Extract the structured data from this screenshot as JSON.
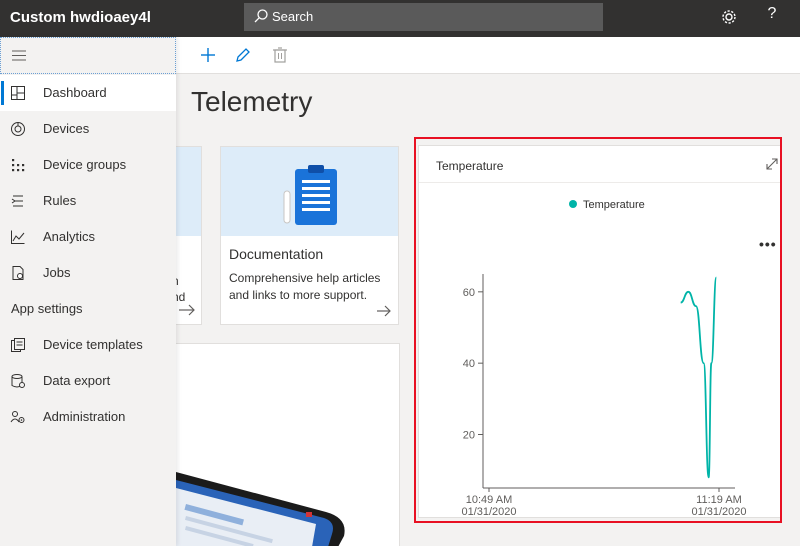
{
  "header": {
    "app_title": "Custom hwdioaey4l",
    "search_placeholder": "Search",
    "icons": {
      "search": "search-icon",
      "settings": "gear-icon",
      "help": "help-icon"
    },
    "help_glyph": "?"
  },
  "toolbar": {
    "buttons": [
      {
        "name": "add",
        "icon": "plus-icon"
      },
      {
        "name": "edit",
        "icon": "pencil-icon"
      },
      {
        "name": "delete",
        "icon": "trash-icon"
      }
    ]
  },
  "sidebar": {
    "menu_icon": "hamburger-icon",
    "items": [
      {
        "label": "Dashboard",
        "icon": "dashboard-icon",
        "active": true
      },
      {
        "label": "Devices",
        "icon": "devices-icon"
      },
      {
        "label": "Device groups",
        "icon": "device-groups-icon"
      },
      {
        "label": "Rules",
        "icon": "rules-icon"
      },
      {
        "label": "Analytics",
        "icon": "analytics-icon"
      },
      {
        "label": "Jobs",
        "icon": "jobs-icon"
      }
    ],
    "section_label": "App settings",
    "settings_items": [
      {
        "label": "Device templates",
        "icon": "device-templates-icon"
      },
      {
        "label": "Data export",
        "icon": "data-export-icon"
      },
      {
        "label": "Administration",
        "icon": "administration-icon"
      }
    ]
  },
  "main": {
    "title": "Telemetry",
    "partial_tile": {
      "line1": "n",
      "line2": "nd"
    },
    "doc_tile": {
      "title": "Documentation",
      "description": "Comprehensive help articles and links to more support."
    },
    "telemetry_tile": {
      "title": "Temperature",
      "legend": "Temperature",
      "more": "•••"
    }
  },
  "colors": {
    "topbar": "#323130",
    "accent": "#0078d4",
    "series": "#00b4a8",
    "highlight": "#e81123",
    "tile_band": "#ddecf9"
  },
  "chart_data": {
    "type": "line",
    "title": "Temperature",
    "series": [
      {
        "name": "Temperature",
        "points": [
          {
            "x": "11:14 AM",
            "y": 57
          },
          {
            "x": "11:15 AM",
            "y": 60
          },
          {
            "x": "11:16 AM",
            "y": 56
          },
          {
            "x": "11:17 AM",
            "y": 40
          },
          {
            "x": "11:17 AM",
            "y": 8
          },
          {
            "x": "11:18 AM",
            "y": 40
          },
          {
            "x": "11:18 AM",
            "y": 64
          }
        ]
      }
    ],
    "x_ticks": [
      {
        "time": "10:49 AM",
        "date": "01/31/2020"
      },
      {
        "time": "11:19 AM",
        "date": "01/31/2020"
      }
    ],
    "y_ticks": [
      20,
      40,
      60
    ],
    "ylim": [
      5,
      65
    ],
    "grid": false,
    "legend_position": "top-center"
  }
}
